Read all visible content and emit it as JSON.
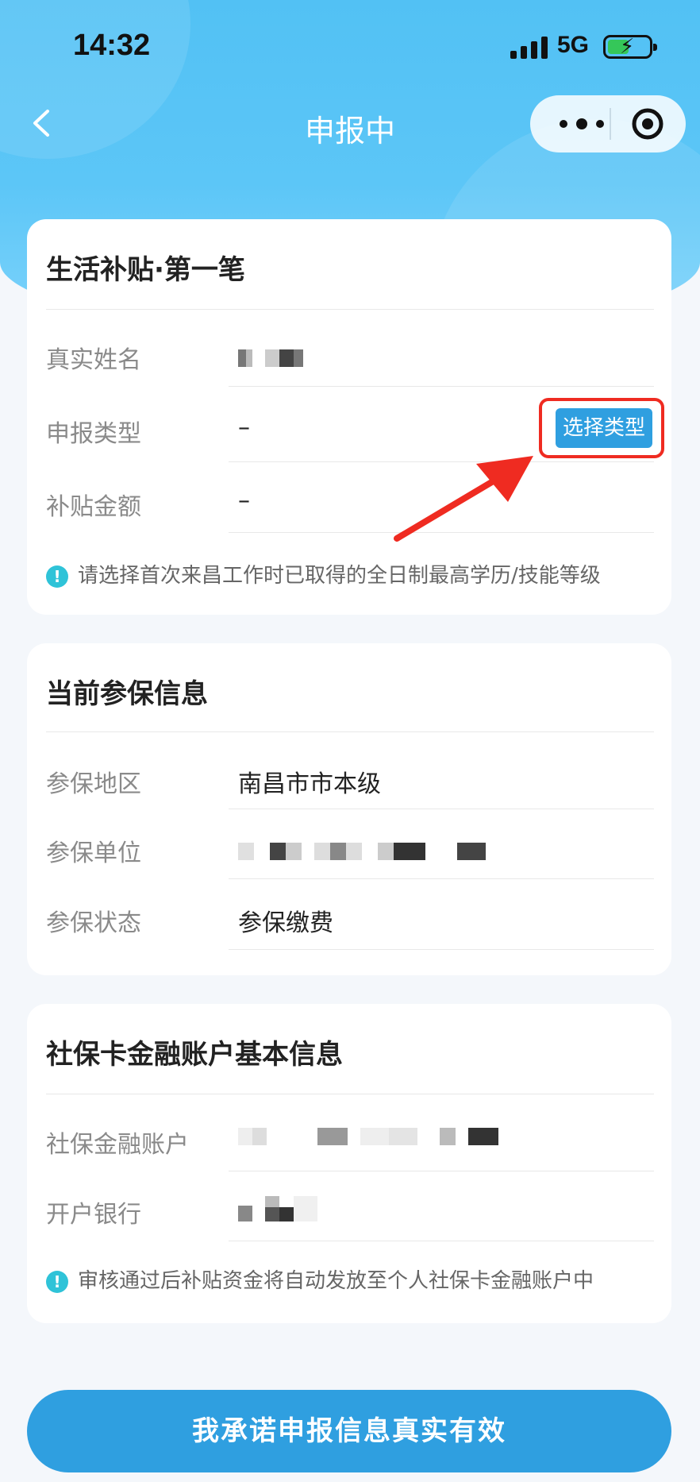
{
  "status_bar": {
    "time": "14:32",
    "network": "5G"
  },
  "nav": {
    "title": "申报中"
  },
  "subsidy_card": {
    "title": "生活补贴·第一笔",
    "rows": [
      {
        "label": "真实姓名",
        "value": ""
      },
      {
        "label": "申报类型",
        "value": "–"
      },
      {
        "label": "补贴金额",
        "value": "–"
      }
    ],
    "select_button": "选择类型",
    "tip": "请选择首次来昌工作时已取得的全日制最高学历/技能等级"
  },
  "insurance_card": {
    "title": "当前参保信息",
    "rows": [
      {
        "label": "参保地区",
        "value": "南昌市市本级"
      },
      {
        "label": "参保单位",
        "value": ""
      },
      {
        "label": "参保状态",
        "value": "参保缴费"
      }
    ]
  },
  "bank_card": {
    "title": "社保卡金融账户基本信息",
    "rows": [
      {
        "label": "社保金融账户",
        "value": ""
      },
      {
        "label": "开户银行",
        "value": ""
      }
    ],
    "tip": "审核通过后补贴资金将自动发放至个人社保卡金融账户中"
  },
  "cta": {
    "label": "我承诺申报信息真实有效"
  },
  "colors": {
    "accent": "#2f9fe0",
    "highlight": "#ef2b21",
    "tip_icon": "#2fc3d8"
  }
}
